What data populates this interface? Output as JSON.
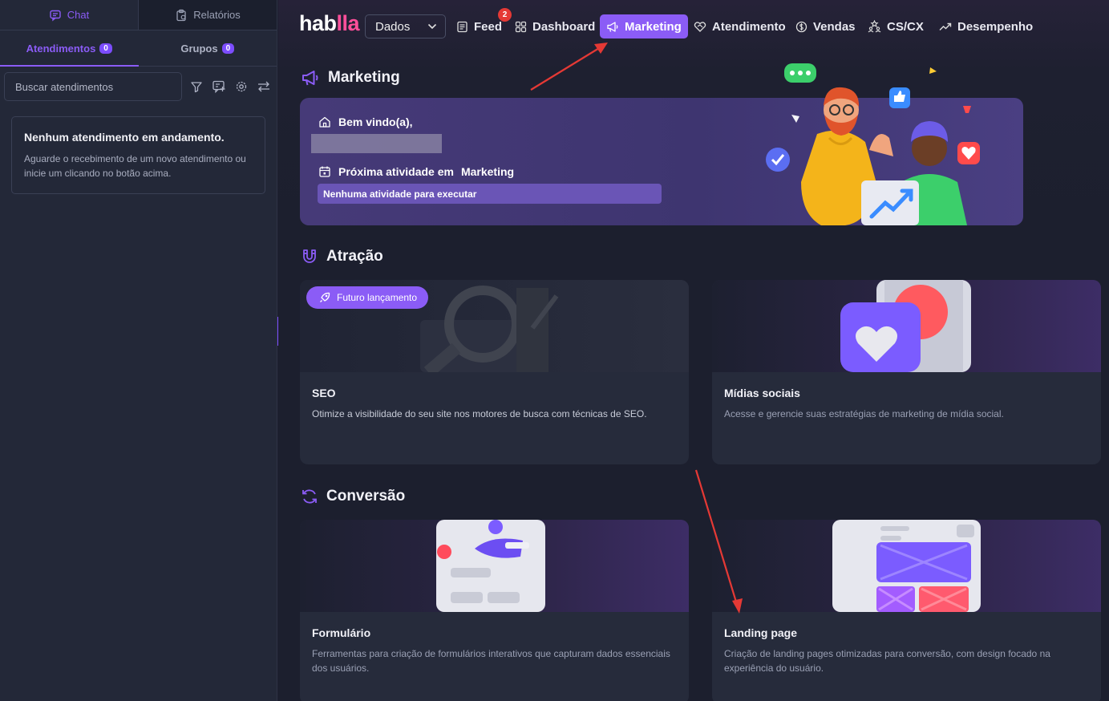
{
  "left_panel": {
    "tabs": {
      "chat": "Chat",
      "reports": "Relatórios"
    },
    "subtabs": {
      "attendances": {
        "label": "Atendimentos",
        "count": "0"
      },
      "groups": {
        "label": "Grupos",
        "count": "0"
      }
    },
    "search": {
      "placeholder": "Buscar atendimentos"
    },
    "empty_state": {
      "title": "Nenhum atendimento em andamento.",
      "text": "Aguarde o recebimento de um novo atendimento ou inicie um clicando no botão acima."
    }
  },
  "nav": {
    "logo": {
      "part1": "hab",
      "part2": "lla"
    },
    "select_value": "Dados",
    "items": {
      "feed": {
        "label": "Feed",
        "badge": "2"
      },
      "dashboard": {
        "label": "Dashboard"
      },
      "marketing": {
        "label": "Marketing"
      },
      "atendimento": {
        "label": "Atendimento"
      },
      "vendas": {
        "label": "Vendas"
      },
      "cscx": {
        "label": "CS/CX"
      },
      "desempenho": {
        "label": "Desempenho"
      }
    }
  },
  "page": {
    "title": "Marketing",
    "welcome": {
      "greeting": "Bem vindo(a),",
      "next_activity_label": "Próxima atividade em",
      "next_activity_module": "Marketing",
      "no_activity": "Nenhuma atividade para executar"
    },
    "sections": {
      "attraction": {
        "title": "Atração",
        "cards": {
          "seo": {
            "badge": "Futuro lançamento",
            "title": "SEO",
            "description": "Otimize a visibilidade do seu site nos motores de busca com técnicas de SEO."
          },
          "social": {
            "title": "Mídias sociais",
            "description": "Acesse e gerencie suas estratégias de marketing de mídia social."
          }
        }
      },
      "conversion": {
        "title": "Conversão",
        "cards": {
          "form": {
            "title": "Formulário",
            "description": "Ferramentas para criação de formulários interativos que capturam dados essenciais dos usuários."
          },
          "landing": {
            "title": "Landing page",
            "description": "Criação de landing pages otimizadas para conversão, com design focado na experiência do usuário."
          }
        }
      }
    }
  },
  "colors": {
    "accent": "#8b5cf6",
    "badge_red": "#e53935",
    "annotation_arrow": "#e53935",
    "logo_accent": "#ff4f9a"
  }
}
